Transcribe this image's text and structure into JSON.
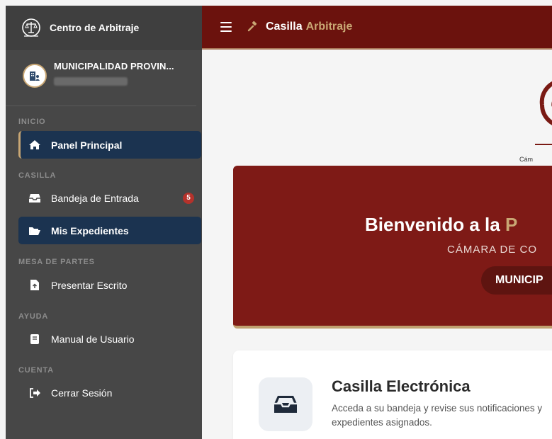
{
  "brand": {
    "title": "Centro de Arbitraje"
  },
  "user": {
    "name": "MUNICIPALIDAD PROVIN..."
  },
  "sidebar": {
    "sections": [
      "INICIO",
      "CASILLA",
      "MESA DE PARTES",
      "AYUDA",
      "CUENTA"
    ],
    "items": [
      {
        "label": "Panel Principal",
        "icon": "home-icon",
        "active": true
      },
      {
        "label": "Bandeja de Entrada",
        "icon": "inbox-icon",
        "badge": "5"
      },
      {
        "label": "Mis Expedientes",
        "icon": "folder-open-icon",
        "active": true
      },
      {
        "label": "Presentar Escrito",
        "icon": "file-upload-icon"
      },
      {
        "label": "Manual de Usuario",
        "icon": "book-icon"
      },
      {
        "label": "Cerrar Sesión",
        "icon": "sign-out-icon"
      }
    ]
  },
  "topbar": {
    "title": "Casilla",
    "title_accent": "Arbitraje"
  },
  "logo": {
    "caption": "Cám"
  },
  "hero": {
    "title": "Bienvenido a la ",
    "title_accent": "P",
    "subtitle": "CÁMARA DE CO",
    "pill": "MUNICIP"
  },
  "card": {
    "title": "Casilla Electrónica",
    "description": "Acceda a su bandeja y revise sus notificaciones y expedientes asignados."
  },
  "colors": {
    "sidebar_bg": "#474747",
    "topbar_bg": "#6b120d",
    "hero_bg": "#7e1a16",
    "accent_gold": "#c9a774",
    "active_item": "#1b3350",
    "badge": "#b5322b"
  }
}
